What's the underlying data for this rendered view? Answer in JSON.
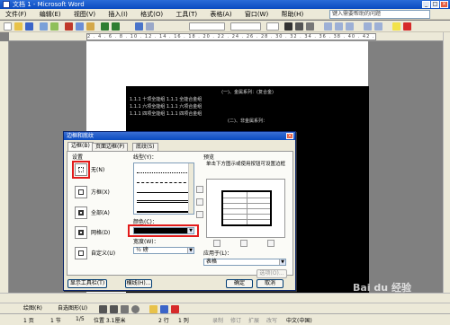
{
  "window": {
    "title": "文档 1 - Microsoft Word"
  },
  "menu": {
    "items": [
      "文件(F)",
      "编辑(E)",
      "视图(V)",
      "插入(I)",
      "格式(O)",
      "工具(T)",
      "表格(A)",
      "窗口(W)",
      "帮助(H)"
    ],
    "help_placeholder": "键入需要帮助的问题"
  },
  "document": {
    "lines": [
      {
        "text": "(一)、金属系列：(复合金)",
        "heading": true
      },
      {
        "text": "1.1.1 十项全能组    1.1.1 全能合金组",
        "heading": false
      },
      {
        "text": "1.1.1 六项全能组    1.1.1 六项合金组",
        "heading": false
      },
      {
        "text": "1.1.1 四项全能组    1.1.1 四项合金组",
        "heading": false
      },
      {
        "text": "(二)、非金属系列：",
        "heading": true
      }
    ]
  },
  "dialog": {
    "title": "边框和底纹",
    "tabs": [
      "边框(B)",
      "页面边框(P)",
      "底纹(S)"
    ],
    "settings_label": "设置",
    "settings": [
      "无(N)",
      "方框(X)",
      "全部(A)",
      "网格(D)",
      "自定义(U)"
    ],
    "style_label": "线型(Y)：",
    "color_label": "颜色(C)：",
    "color_value": "",
    "width_label": "宽度(W)：",
    "width_value": "½ 磅",
    "preview_label": "预览",
    "preview_hint": "单击下方图示或使用按钮可设置边框",
    "apply_to_label": "应用于(L)：",
    "apply_to_value": "表格",
    "options_button": "选项(O)...",
    "toolbar_button": "显示工具栏(T)",
    "hline_button": "横线(H)...",
    "ok_button": "确定",
    "cancel_button": "取消"
  },
  "drawbar": {
    "draw_label": "绘图(R)",
    "autoshape_label": "自选图形(U)"
  },
  "status": {
    "page": "1 页",
    "section": "1 节",
    "page_count": "1/5",
    "position": "位置 3.1厘米",
    "line": "2 行",
    "column": "1 列",
    "rec": "录制",
    "rev": "修订",
    "ext": "扩展",
    "ovr": "改写",
    "lang": "中文(中国)"
  },
  "watermark": "Bai du 经验",
  "colors": {
    "highlight_red": "#e21b1b",
    "title_blue": "#0a4bc0"
  }
}
